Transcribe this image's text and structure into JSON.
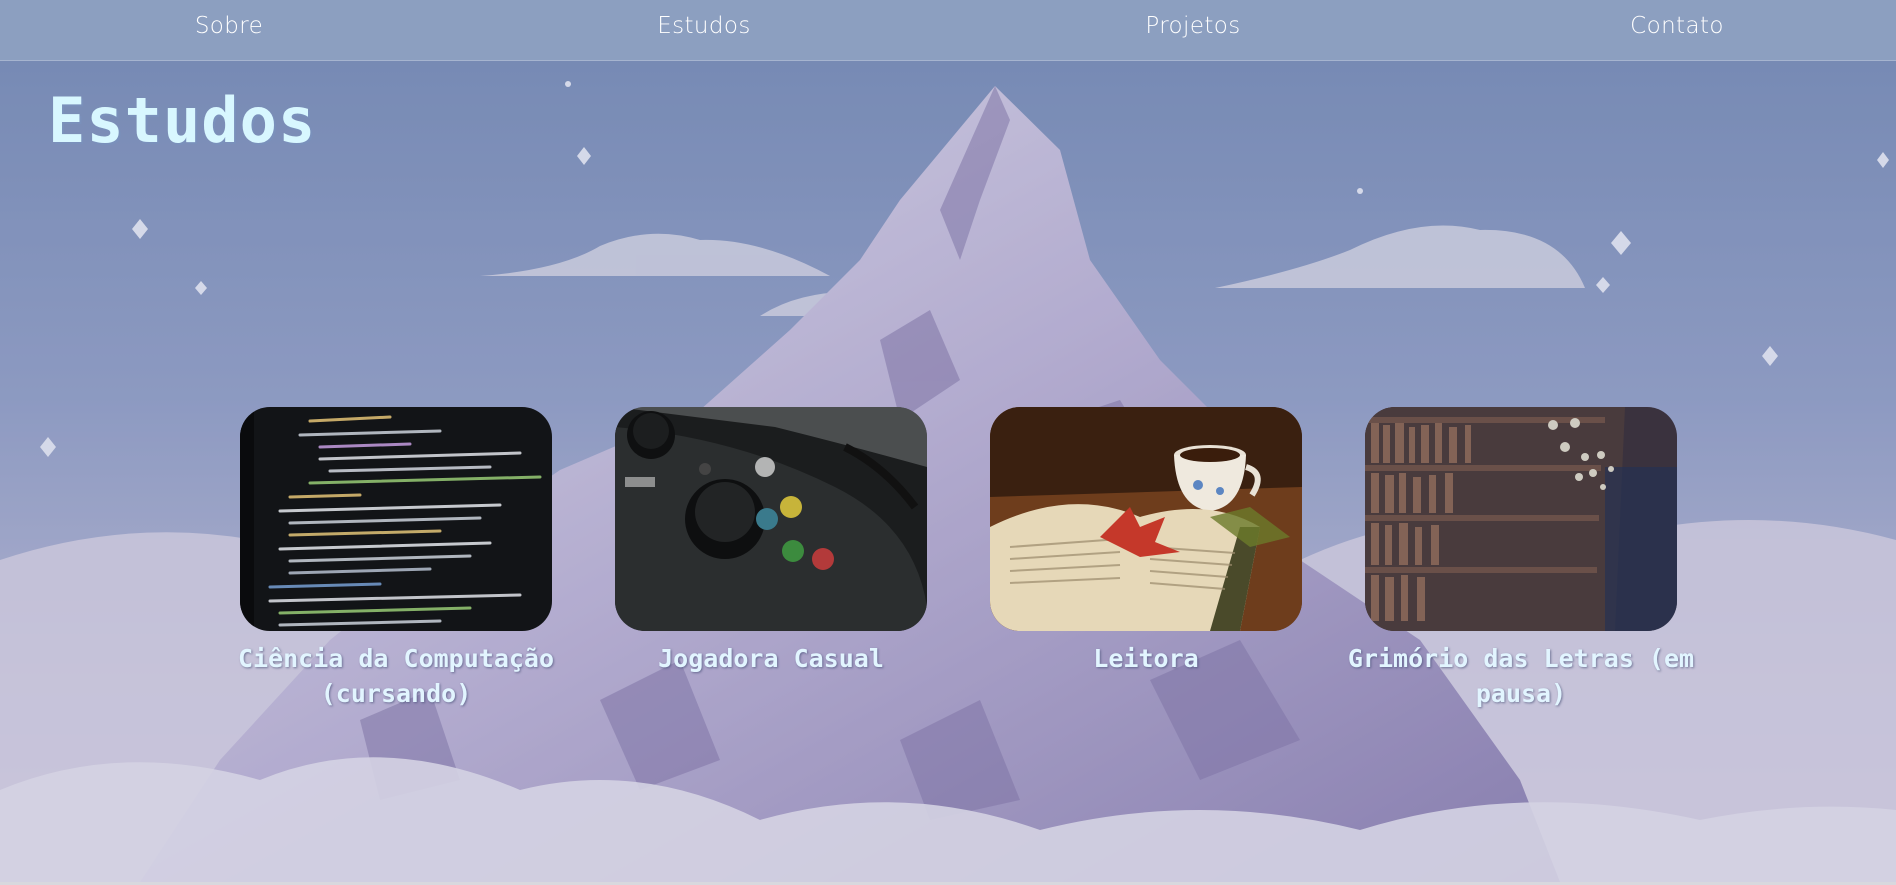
{
  "nav": {
    "items": [
      {
        "label": "Sobre"
      },
      {
        "label": "Estudos"
      },
      {
        "label": "Projetos"
      },
      {
        "label": "Contato"
      }
    ]
  },
  "page": {
    "title": "Estudos"
  },
  "cards": [
    {
      "label": "Ciência da Computação (cursando)",
      "image": "code-screen-photo"
    },
    {
      "label": "Jogadora Casual",
      "image": "game-controller-photo"
    },
    {
      "label": "Leitora",
      "image": "open-book-tea-photo"
    },
    {
      "label": "Grimório das Letras (em pausa)",
      "image": "library-shelves-photo"
    }
  ],
  "colors": {
    "navbar": "#8c9fc0",
    "title": "#d8f7ff",
    "card_label": "#e2f5ff",
    "sky": "#6f84b0"
  }
}
